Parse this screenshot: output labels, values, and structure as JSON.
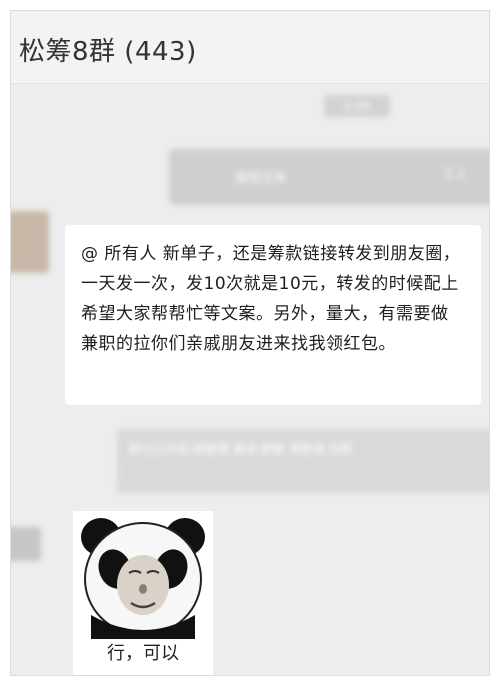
{
  "header": {
    "title": "松筹8群 (443)"
  },
  "timestamp": {
    "label": "1:04"
  },
  "sent_message": {
    "left_text": "复制文本",
    "right_text": "2.1"
  },
  "message": {
    "text": "@ 所有人 新单子，还是筹款链接转发到朋友圈，一天发一次，发10次就是10元，转发的时候配上希望大家帮帮忙等文案。另外，量大，有需要做兼职的拉你们亲戚朋友进来找我领红包。"
  },
  "system_notice": {
    "text": "群主已开启 群管理 邀请 群聊 请邀请 加群"
  },
  "sticker": {
    "caption": "行，可以",
    "icon": "panda-face-icon"
  }
}
